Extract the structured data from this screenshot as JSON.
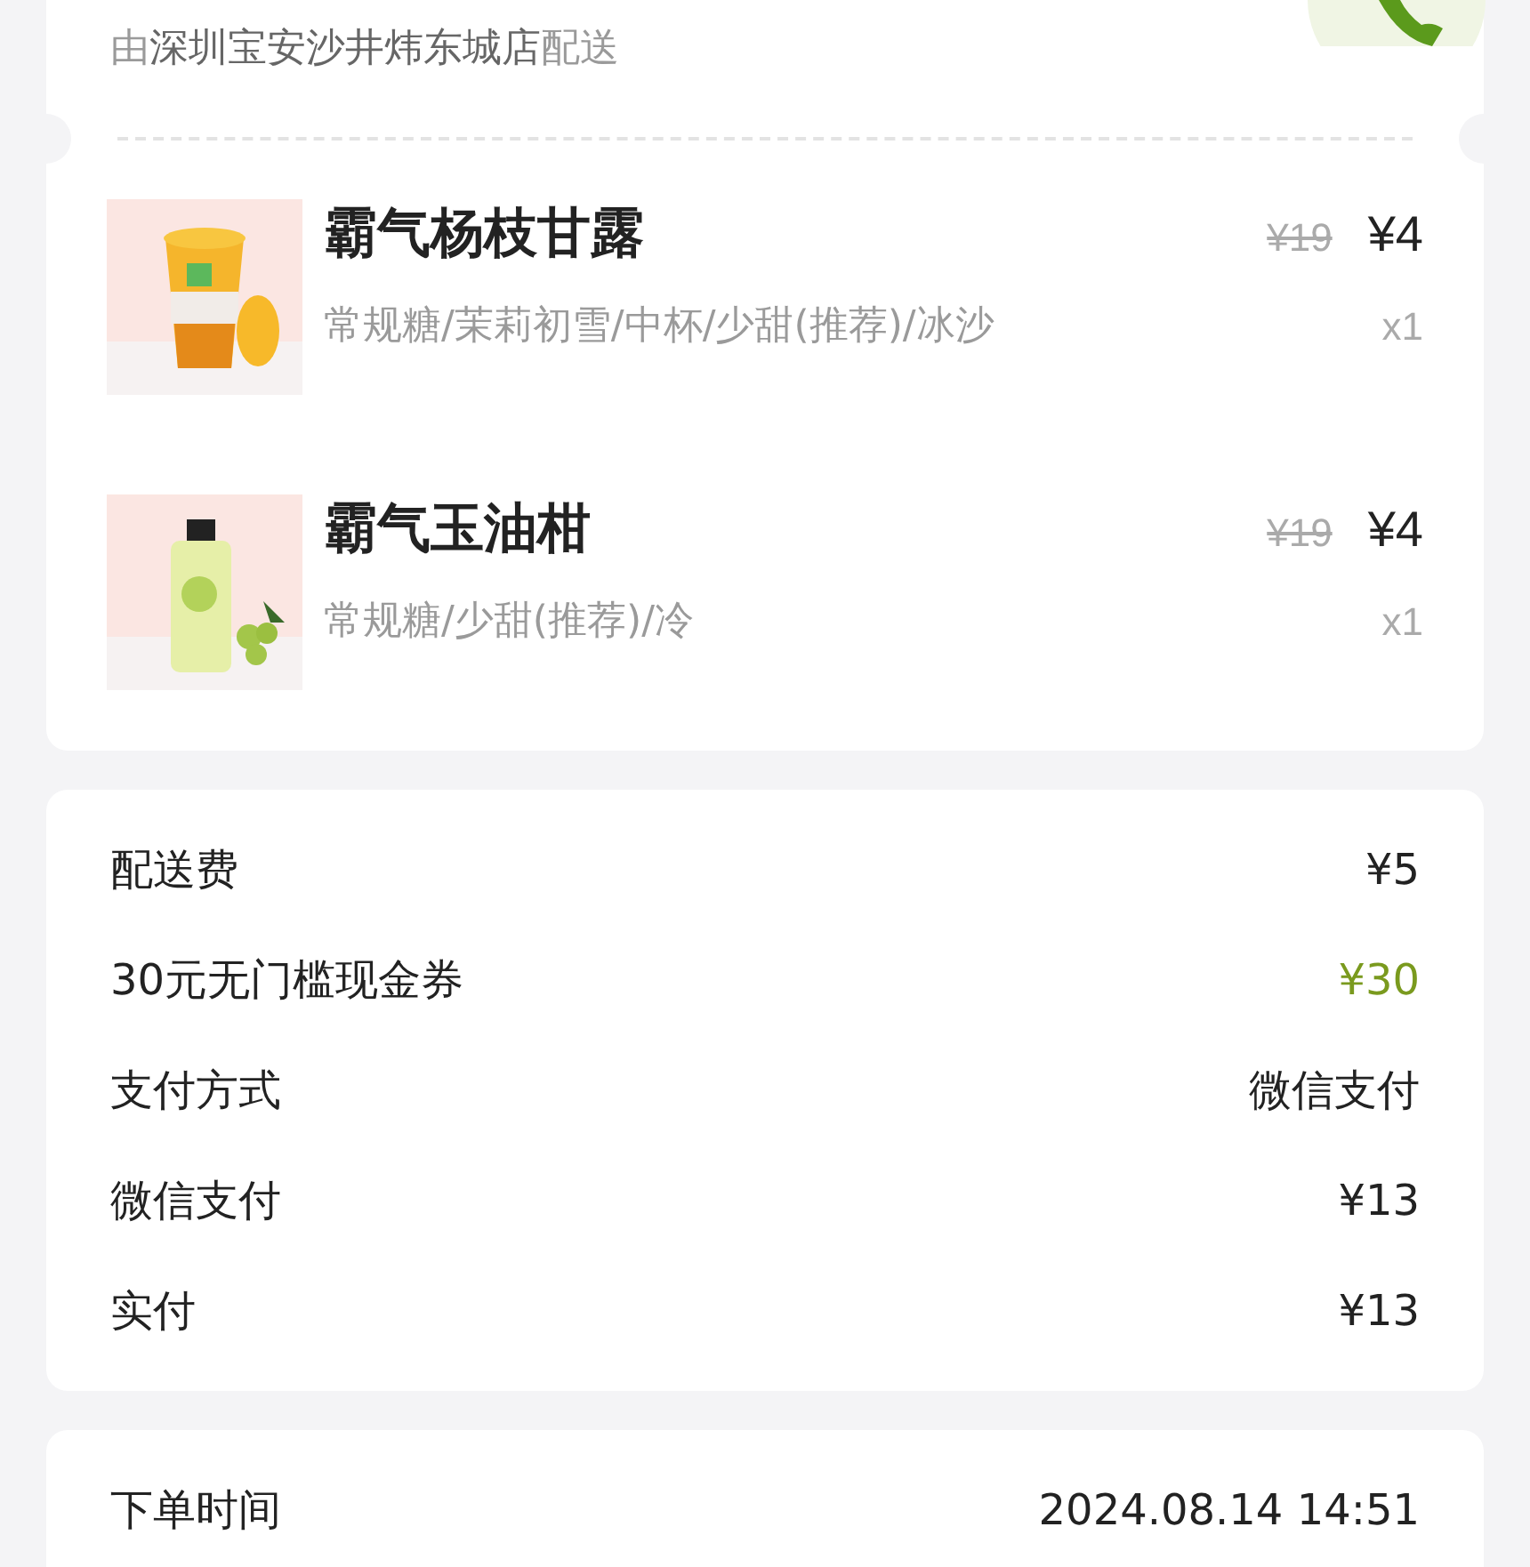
{
  "store": {
    "prefix": "由",
    "name": "深圳宝安沙井炜东城店",
    "suffix": "配送"
  },
  "items": [
    {
      "kind": "picture",
      "name": "霸气杨枝甘露",
      "specs": "常规糖/茉莉初雪/中杯/少甜(推荐)/冰沙",
      "original_price": "¥19",
      "price": "¥4",
      "quantity": "x1"
    },
    {
      "kind": "picture",
      "name": "霸气玉油柑",
      "specs": "常规糖/少甜(推荐)/冷",
      "original_price": "¥19",
      "price": "¥4",
      "quantity": "x1"
    }
  ],
  "summary": [
    {
      "label": "配送费",
      "value": "¥5",
      "kind": "plain"
    },
    {
      "label": "30元无门槛现金券",
      "value": "¥30",
      "kind": "discount"
    },
    {
      "label": "支付方式",
      "value": "微信支付",
      "kind": "plain"
    },
    {
      "label": "微信支付",
      "value": "¥13",
      "kind": "plain"
    },
    {
      "label": "实付",
      "value": "¥13",
      "kind": "plain"
    }
  ],
  "order_info": [
    {
      "label": "下单时间",
      "value": "2024.08.14 14:51"
    }
  ]
}
